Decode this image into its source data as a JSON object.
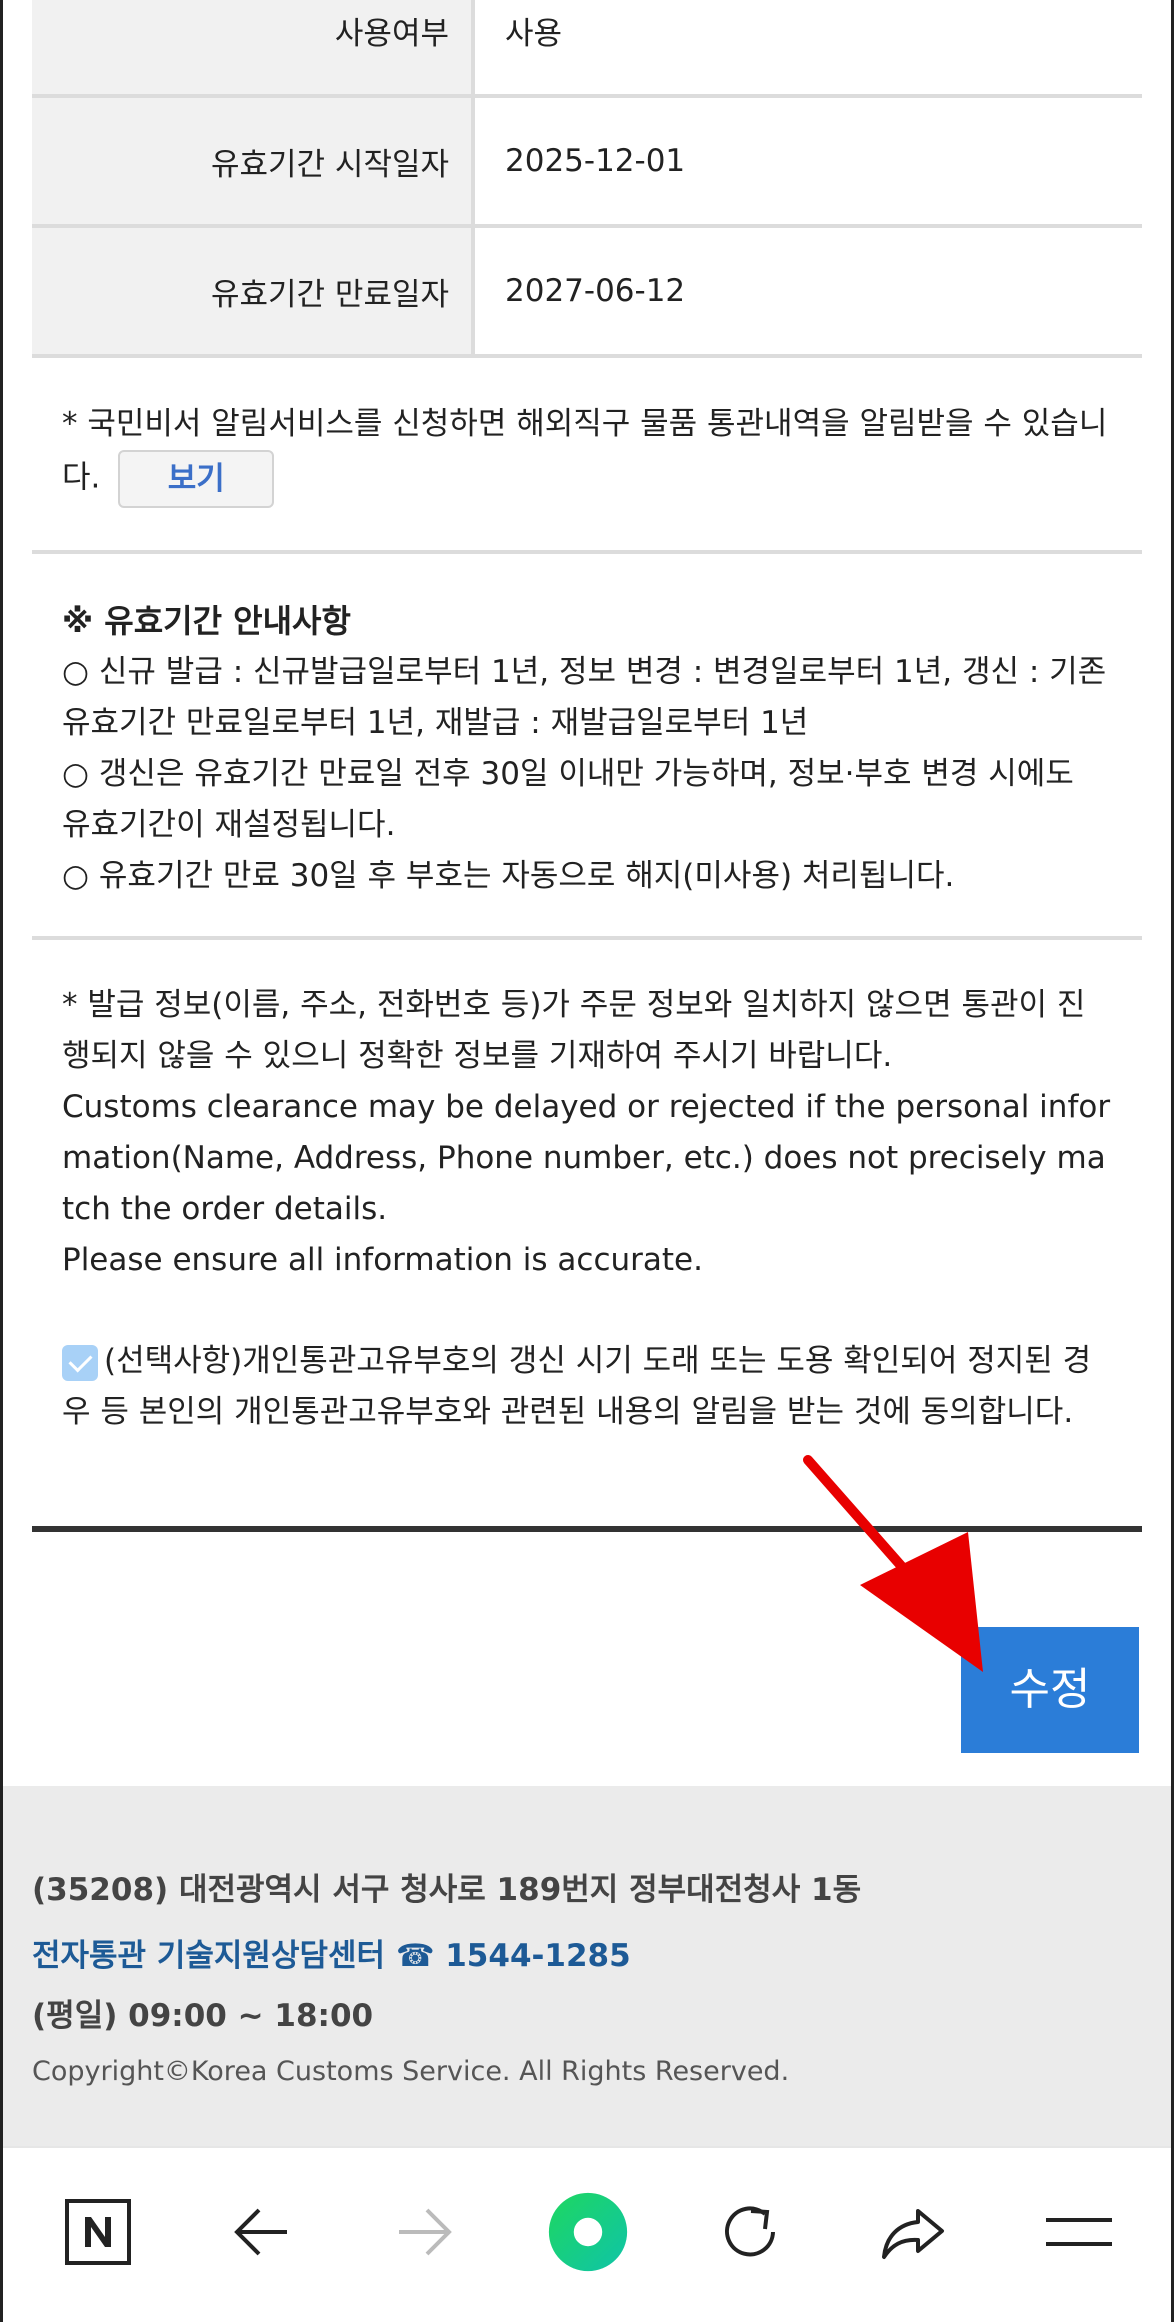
{
  "table": {
    "rows": [
      {
        "label": "사용여부",
        "value": "사용"
      },
      {
        "label": "유효기간 시작일자",
        "value": "2025-12-01"
      },
      {
        "label": "유효기간 만료일자",
        "value": "2027-06-12"
      }
    ]
  },
  "notice1": {
    "text": "* 국민비서 알림서비스를 신청하면 해외직구 물품 통관내역을 알림받을 수 있습니다.",
    "view_button": "보기"
  },
  "notice2": {
    "title": "※ 유효기간 안내사항",
    "line1": "○ 신규 발급 : 신규발급일로부터 1년, 정보 변경 : 변경일로부터 1년, 갱신 : 기존 유효기간 만료일로부터 1년, 재발급 : 재발급일로부터 1년",
    "line2": "○ 갱신은 유효기간 만료일 전후 30일 이내만 가능하며, 정보·부호 변경 시에도 유효기간이 재설정됩니다.",
    "line3": "○ 유효기간 만료 30일 후 부호는 자동으로 해지(미사용) 처리됩니다."
  },
  "notice3": {
    "ko": "* 발급 정보(이름, 주소, 전화번호 등)가 주문 정보와 일치하지 않으면 통관이 진행되지 않을 수 있으니 정확한 정보를 기재하여 주시기 바랍니다.",
    "en1": "Customs clearance may be delayed or rejected if the personal information(Name, Address, Phone number, etc.) does not precisely match the order details.",
    "en2": "Please ensure all information is accurate.",
    "consent": "(선택사항)개인통관고유부호의 갱신 시기 도래 또는 도용 확인되어 정지된 경우 등 본인의 개인통관고유부호와 관련된 내용의 알림을 받는 것에 동의합니다.",
    "consent_checked": true
  },
  "edit_button": "수정",
  "footer": {
    "address": "(35208) 대전광역시 서구 청사로 189번지 정부대전청사 1동",
    "center": "전자통관 기술지원상담센터 ☎ 1544-1285",
    "hours": "(평일) 09:00 ~ 18:00",
    "copyright": "Copyright©Korea Customs Service. All Rights Reserved."
  },
  "navbar": {
    "icons": [
      "naver-home-icon",
      "back-arrow-icon",
      "forward-arrow-icon",
      "green-circle-icon",
      "refresh-icon",
      "share-icon",
      "menu-icon"
    ]
  },
  "colors": {
    "primary_button": "#2b7dd8",
    "link": "#1d5a96",
    "annotation_arrow": "#e80000"
  }
}
